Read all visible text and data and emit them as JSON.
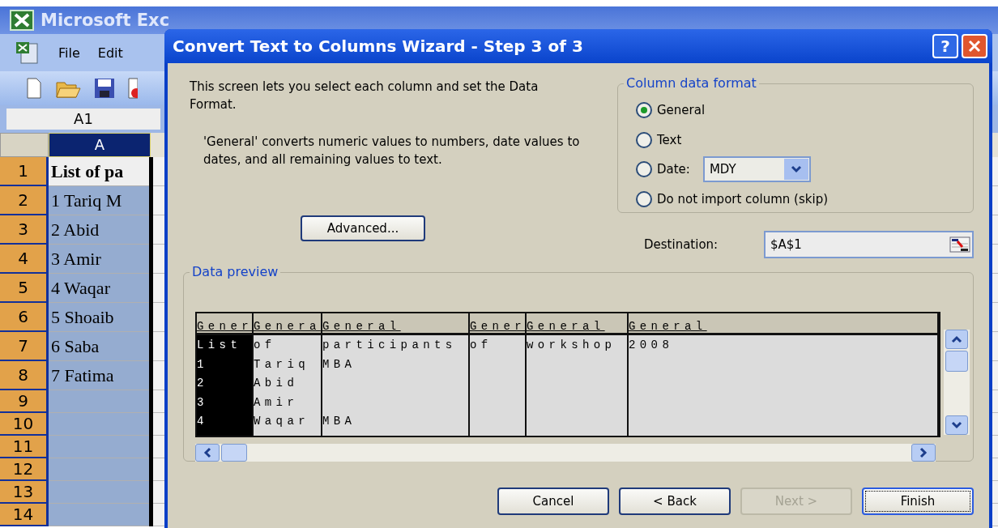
{
  "excel": {
    "title": "Microsoft Exc",
    "menu": [
      "File",
      "Edit"
    ],
    "name_box": "A1",
    "column_header": {
      "label": "A",
      "selected": true
    },
    "rows": [
      {
        "number": "1",
        "text": "List of pa",
        "kind": "heading",
        "active": true,
        "selected": true
      },
      {
        "number": "2",
        "text": "1 Tariq M",
        "kind": "data",
        "active": false,
        "selected": true
      },
      {
        "number": "3",
        "text": "2 Abid",
        "kind": "data",
        "active": false,
        "selected": true
      },
      {
        "number": "4",
        "text": "3 Amir",
        "kind": "data",
        "active": false,
        "selected": true
      },
      {
        "number": "5",
        "text": "4 Waqar",
        "kind": "data",
        "active": false,
        "selected": true
      },
      {
        "number": "6",
        "text": "5 Shoaib",
        "kind": "data",
        "active": false,
        "selected": true
      },
      {
        "number": "7",
        "text": "6 Saba",
        "kind": "data",
        "active": false,
        "selected": true
      },
      {
        "number": "8",
        "text": "7 Fatima",
        "kind": "data",
        "active": false,
        "selected": true
      },
      {
        "number": "9",
        "kind": "data",
        "active": false,
        "selected": true
      },
      {
        "number": "10",
        "kind": "data",
        "active": false,
        "selected": true
      },
      {
        "number": "11",
        "kind": "data",
        "active": false,
        "selected": true
      },
      {
        "number": "12",
        "kind": "data",
        "active": false,
        "selected": true
      },
      {
        "number": "13",
        "kind": "data",
        "active": false,
        "selected": true
      },
      {
        "number": "14",
        "kind": "data",
        "active": false,
        "selected": true
      }
    ]
  },
  "dialog": {
    "title": "Convert Text to Columns Wizard - Step 3 of 3",
    "help": "?",
    "intro": "This screen lets you select each column and set the Data Format.",
    "explanation": "'General' converts numeric values to numbers, date values to dates, and all remaining values to text.",
    "advanced_button": "Advanced...",
    "column_data_format": {
      "legend": "Column data format",
      "options": [
        {
          "label": "General",
          "selected": true
        },
        {
          "label": "Text",
          "selected": false
        },
        {
          "label": "Date:",
          "selected": false,
          "kind": "dropdown",
          "dropdown": "MDY"
        },
        {
          "label": "Do not import column (skip)",
          "selected": false
        }
      ]
    },
    "destination": {
      "label": "Destination:",
      "value": "$A$1"
    },
    "data_preview": {
      "legend": "Data preview",
      "columns": [
        {
          "header": "Gener",
          "selected": true
        },
        {
          "header": "Genera",
          "selected": false
        },
        {
          "header": "General",
          "selected": false
        },
        {
          "header": "Gener",
          "selected": false
        },
        {
          "header": "General",
          "selected": false
        },
        {
          "header": "General",
          "selected": false
        }
      ],
      "rows": [
        [
          "List",
          "of",
          "participants",
          "of",
          "workshop",
          "2008"
        ],
        [
          "1",
          "Tariq",
          "MBA",
          null,
          null,
          null
        ],
        [
          "2",
          "Abid",
          null,
          null,
          null,
          null
        ],
        [
          "3",
          "Amir",
          null,
          null,
          null,
          null
        ],
        [
          "4",
          "Waqar",
          "MBA",
          null,
          null,
          null
        ]
      ]
    },
    "buttons": [
      {
        "label": "Cancel",
        "disabled": false,
        "default": false
      },
      {
        "label": "< Back",
        "disabled": false,
        "default": false
      },
      {
        "label": "Next >",
        "disabled": true,
        "default": false
      },
      {
        "label": "Finish",
        "disabled": false,
        "default": true
      }
    ]
  }
}
